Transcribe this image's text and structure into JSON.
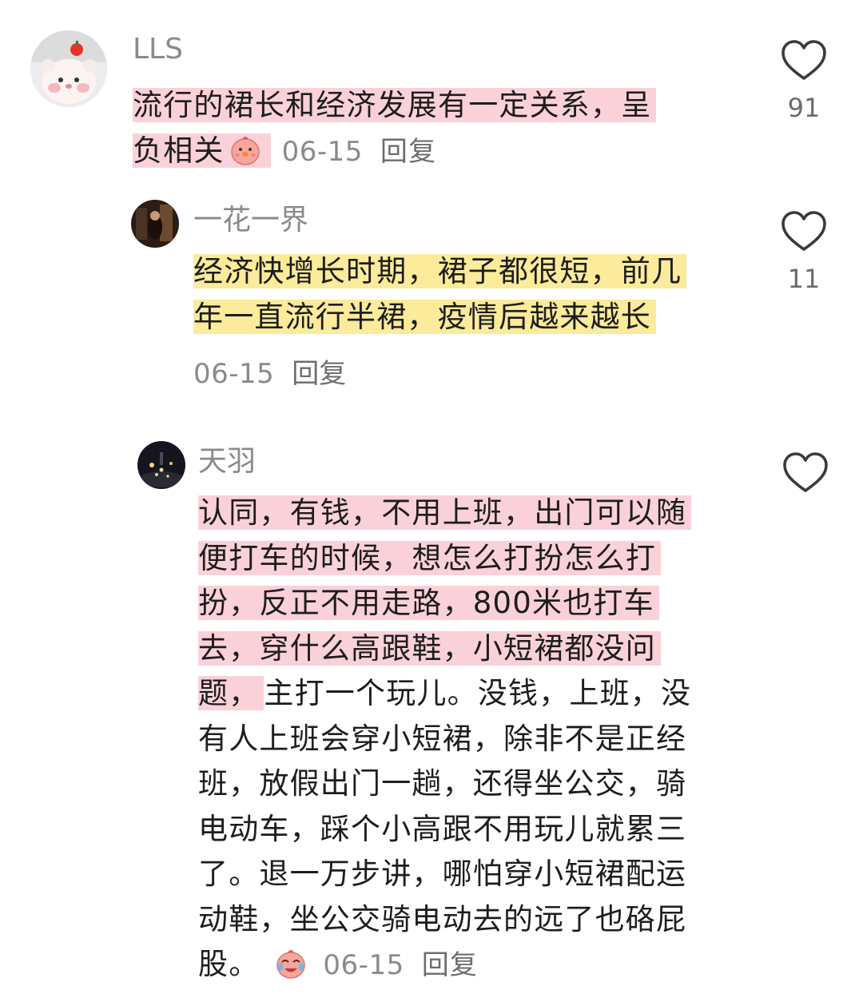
{
  "comments": [
    {
      "user": "LLS",
      "text_lines": [
        "流行的裙长和经济发展有一定关系，呈",
        "负相关"
      ],
      "emoji_icon": "chick-face-emoji",
      "date": "06-15",
      "reply_label": "回复",
      "likes": "91",
      "highlight_color": "#f8c4ce"
    },
    {
      "user": "一花一界",
      "text_lines": [
        "经济快增长时期，裙子都很短，前几",
        "年一直流行半裙，疫情后越来越长"
      ],
      "date": "06-15",
      "reply_label": "回复",
      "likes": "11",
      "highlight_color": "#fae88c"
    },
    {
      "user": "天羽",
      "text_highlighted_lines": [
        "认同，有钱，不用上班，出门可以随",
        "便打车的时候，想怎么打扮怎么打",
        "扮，反正不用走路，800米也打车",
        "去，穿什么高跟鞋，小短裙都没问",
        "题，"
      ],
      "text_plain_continuation": "主打一个玩儿。没钱，上班，没",
      "text_plain_lines": [
        "有人上班会穿小短裙，除非不是正经",
        "班，放假出门一趟，还得坐公交，骑",
        "电动车，踩个小高跟不用玩儿就累三",
        "了。退一万步讲，哪怕穿小短裙配运",
        "动鞋，坐公交骑电动去的远了也硌屁",
        "股。"
      ],
      "emoji_icon": "crying-laughing-chick-emoji",
      "date": "06-15",
      "reply_label": "回复",
      "likes": "",
      "highlight_color": "#f8c4ce"
    }
  ]
}
